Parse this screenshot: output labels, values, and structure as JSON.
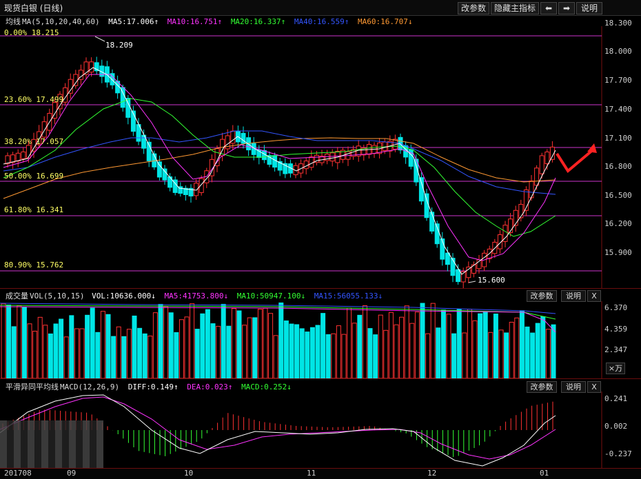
{
  "window": {
    "title": "现货白银 (日线)"
  },
  "toolbar": {
    "params_label": "改参数",
    "hide_indicator_label": "隐藏主指标",
    "left_arrow": "⬅",
    "right_arrow": "➡",
    "help_label": "说明"
  },
  "main_panel": {
    "legend": {
      "name": "均线",
      "formula": "MA(5,10,20,40,60)",
      "ma5": "MA5:17.006↑",
      "ma10": "MA10:16.751↑",
      "ma20": "MA20:16.337↑",
      "ma40": "MA40:16.559↑",
      "ma60": "MA60:16.707↓"
    },
    "fib_labels": [
      "0.00% 18.215",
      "23.60% 17.499",
      "38.20% 17.057",
      "50.00% 16.699",
      "61.80% 16.341",
      "80.90% 15.762"
    ],
    "high_label": "18.209",
    "low_label": "15.600",
    "y_ticks": [
      "18.300",
      "18.000",
      "17.700",
      "17.400",
      "17.100",
      "16.800",
      "16.500",
      "16.200",
      "15.900"
    ]
  },
  "volume_panel": {
    "legend": {
      "name": "成交量",
      "formula": "VOL(5,10,15)",
      "vol": "VOL:10636.000↓",
      "ma5": "MA5:41753.800↓",
      "ma10": "MA10:50947.100↓",
      "ma15": "MA15:56055.133↓"
    },
    "params_label": "改参数",
    "help_label": "说明",
    "close_label": "X",
    "y_ticks": [
      "6.370",
      "4.359",
      "2.347"
    ],
    "unit_label": "×万"
  },
  "macd_panel": {
    "legend": {
      "name": "平滑异同平均线",
      "formula": "MACD(12,26,9)",
      "diff": "DIFF:0.149↑",
      "dea": "DEA:0.023↑",
      "macd": "MACD:0.252↓"
    },
    "params_label": "改参数",
    "help_label": "说明",
    "close_label": "X",
    "y_ticks": [
      "0.241",
      "0.002",
      "-0.237"
    ]
  },
  "date_axis": [
    "201708",
    "09",
    "10",
    "11",
    "12",
    "01"
  ],
  "colors": {
    "up": "#ff3232",
    "down": "#00e5e5",
    "ma5": "#ffffff",
    "ma10": "#ff33ff",
    "ma20": "#33ff33",
    "ma40": "#3355ff",
    "ma60": "#ff9933",
    "fib": "#cc33cc",
    "fib_text": "#ffff66"
  }
}
